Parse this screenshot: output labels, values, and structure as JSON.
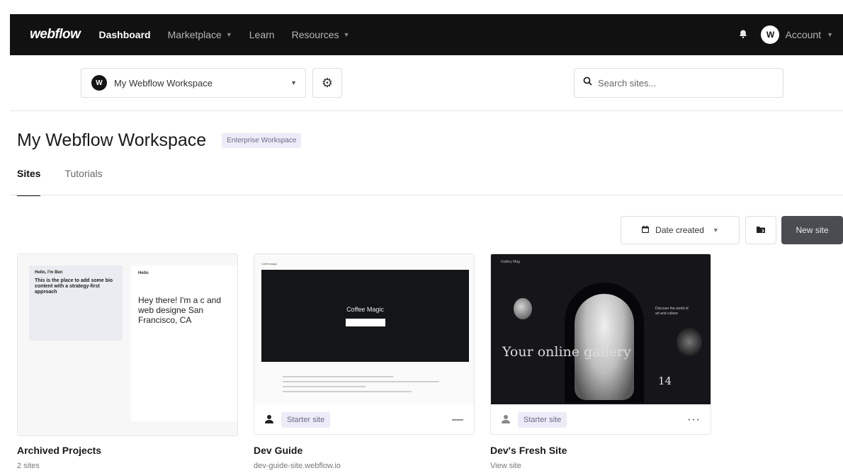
{
  "nav": {
    "logo": "webflow",
    "items": [
      {
        "label": "Dashboard",
        "active": true
      },
      {
        "label": "Marketplace",
        "dropdown": true
      },
      {
        "label": "Learn"
      },
      {
        "label": "Resources",
        "dropdown": true
      }
    ],
    "account_label": "Account",
    "avatar_letter": "W",
    "bell_icon": "bell-icon"
  },
  "toolbar": {
    "workspace_select": "My Webflow Workspace",
    "workspace_logo": "W",
    "search_placeholder": "Search sites..."
  },
  "page": {
    "title": "My Webflow Workspace",
    "badge": "Enterprise Workspace",
    "tabs": [
      {
        "label": "Sites",
        "active": true
      },
      {
        "label": "Tutorials"
      }
    ]
  },
  "actions": {
    "sort_label": "Date created",
    "new_site_label": "New site"
  },
  "cards": [
    {
      "name": "Archived Projects",
      "sub": "2 sites",
      "thumb_text_small": "Hello",
      "thumb_text_big": "Hey there! I'm a c and web designe San Francisco, CA",
      "thumb_card_title": "Hello, I'm Ben",
      "thumb_card_body": "This is the place to add some bio content with a strategy-first approach"
    },
    {
      "name": "Dev Guide",
      "sub": "dev-guide-site.webflow.io",
      "badge": "Starter site",
      "thumb_hero_title": "Coffee Magic",
      "thumb_brand": "Coffeemagic"
    },
    {
      "name": "Dev's Fresh Site",
      "sub": "View site",
      "badge": "Starter site",
      "thumb_text": "Your online gallery",
      "thumb_number": "14",
      "thumb_brand": "Gallery Mag",
      "thumb_side": "Discover the world of art and culture"
    }
  ]
}
